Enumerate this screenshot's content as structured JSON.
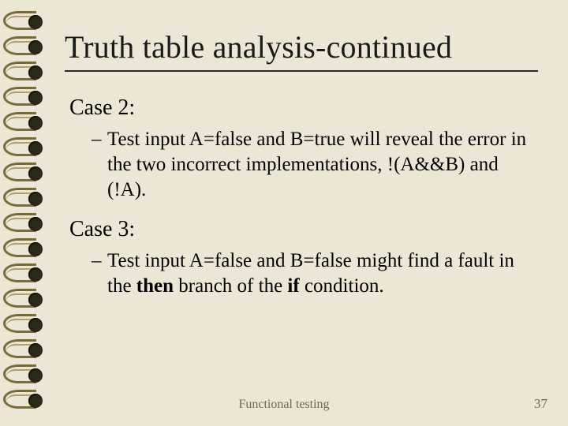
{
  "title": "Truth table analysis-continued",
  "case2": {
    "label": "Case 2:",
    "text": "Test input A=false and B=true will reveal the error in the two incorrect implementations, !(A&&B) and (!A)."
  },
  "case3": {
    "label": "Case 3:",
    "pre": "Test input A=false and B=false might find a fault in the ",
    "b1": "then",
    "mid": " branch of the ",
    "b2": "if",
    "post": " condition."
  },
  "footer": {
    "text": "Functional testing",
    "page": "37"
  }
}
